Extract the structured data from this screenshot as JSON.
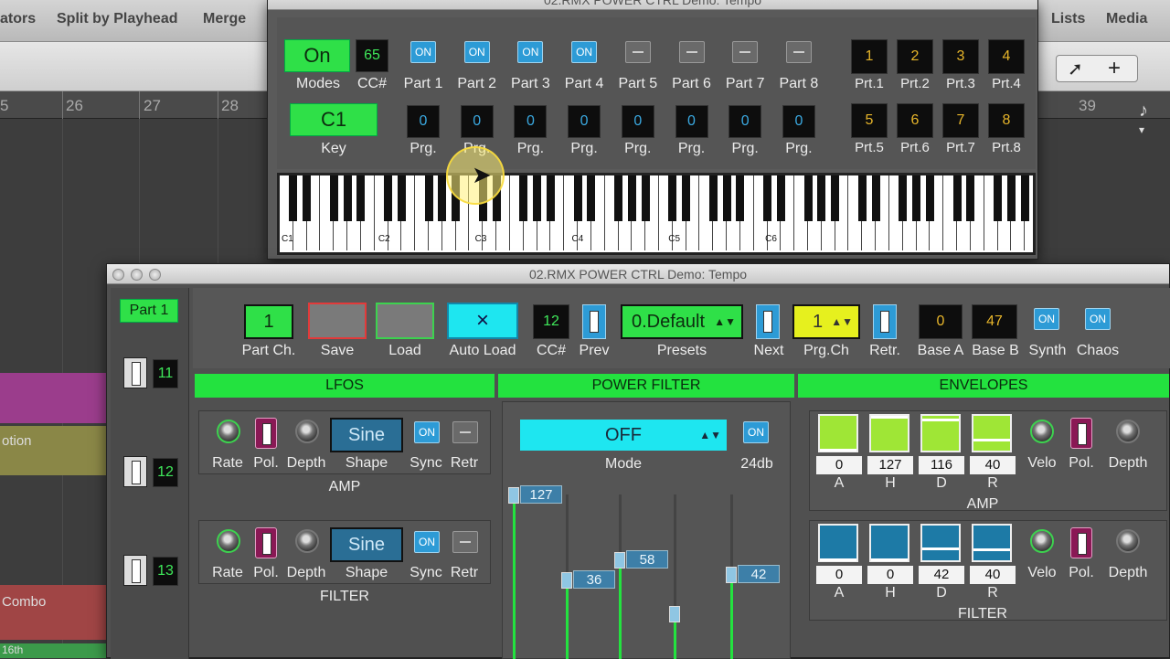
{
  "daw": {
    "toolbar": [
      "ators",
      "Split by Playhead",
      "Merge"
    ],
    "toolbar_right": [
      "Lists",
      "Media"
    ],
    "ruler": [
      "5",
      "26",
      "27",
      "28",
      "39"
    ],
    "tracks": [
      "otion",
      "Combo",
      "16th"
    ]
  },
  "top_window": {
    "title": "02.RMX POWER CTRL Demo: Tempo",
    "mode_btn": "On",
    "mode_label": "Modes",
    "cc_value": "65",
    "cc_label": "CC#",
    "key_value": "C1",
    "key_label": "Key",
    "parts": [
      {
        "state": "ON",
        "label": "Part 1",
        "prg": "0"
      },
      {
        "state": "ON",
        "label": "Part 2",
        "prg": "0"
      },
      {
        "state": "ON",
        "label": "Part 3",
        "prg": "0"
      },
      {
        "state": "ON",
        "label": "Part 4",
        "prg": "0"
      },
      {
        "state": "OFF",
        "label": "Part 5",
        "prg": "0"
      },
      {
        "state": "OFF",
        "label": "Part 6",
        "prg": "0"
      },
      {
        "state": "OFF",
        "label": "Part 7",
        "prg": "0"
      },
      {
        "state": "OFF",
        "label": "Part 8",
        "prg": "0"
      }
    ],
    "prg_label": "Prg.",
    "prt": [
      {
        "v": "1",
        "l": "Prt.1"
      },
      {
        "v": "2",
        "l": "Prt.2"
      },
      {
        "v": "3",
        "l": "Prt.3"
      },
      {
        "v": "4",
        "l": "Prt.4"
      },
      {
        "v": "5",
        "l": "Prt.5"
      },
      {
        "v": "6",
        "l": "Prt.6"
      },
      {
        "v": "7",
        "l": "Prt.7"
      },
      {
        "v": "8",
        "l": "Prt.8"
      }
    ],
    "octaves": [
      "C1",
      "C2",
      "C3",
      "C4",
      "C5",
      "C6"
    ]
  },
  "main_window": {
    "title": "02.RMX POWER CTRL Demo: Tempo",
    "part_sel": "Part 1",
    "side_nums": [
      "11",
      "12",
      "13"
    ],
    "part_ch": "1",
    "part_ch_label": "Part Ch.",
    "save_label": "Save",
    "load_label": "Load",
    "auto_load_label": "Auto Load",
    "auto_load_icon": "×",
    "cc": "12",
    "cc_label": "CC#",
    "prev_label": "Prev",
    "preset": "0.Default",
    "presets_label": "Presets",
    "next_label": "Next",
    "prgch": "1",
    "prgch_label": "Prg.Ch",
    "retr_label": "Retr.",
    "base_a": "0",
    "base_a_label": "Base A",
    "base_b": "47",
    "base_b_label": "Base B",
    "synth_label": "Synth",
    "chaos_label": "Chaos",
    "on": "ON",
    "lfos": {
      "header": "LFOS",
      "rows": [
        {
          "shape": "Sine",
          "group": "AMP"
        },
        {
          "shape": "Sine",
          "group": "FILTER"
        }
      ],
      "labels": {
        "rate": "Rate",
        "pol": "Pol.",
        "depth": "Depth",
        "shape": "Shape",
        "sync": "Sync",
        "retr": "Retr"
      }
    },
    "filter": {
      "header": "POWER FILTER",
      "mode": "OFF",
      "mode_label": "Mode",
      "db_label": "24db",
      "sliders": [
        127,
        36,
        58,
        0,
        42
      ]
    },
    "envelopes": {
      "header": "ENVELOPES",
      "amp": {
        "values": [
          "0",
          "127",
          "116",
          "40"
        ],
        "group": "AMP"
      },
      "filter": {
        "values": [
          "0",
          "0",
          "42",
          "40"
        ],
        "group": "FILTER"
      },
      "letters": [
        "A",
        "H",
        "D",
        "R"
      ],
      "velo": "Velo",
      "pol": "Pol.",
      "depth": "Depth"
    }
  },
  "colors": {
    "green": "#2fe048",
    "blue": "#2d9bd6",
    "cyan": "#1ee6f0",
    "yellow": "#e6f01e"
  }
}
